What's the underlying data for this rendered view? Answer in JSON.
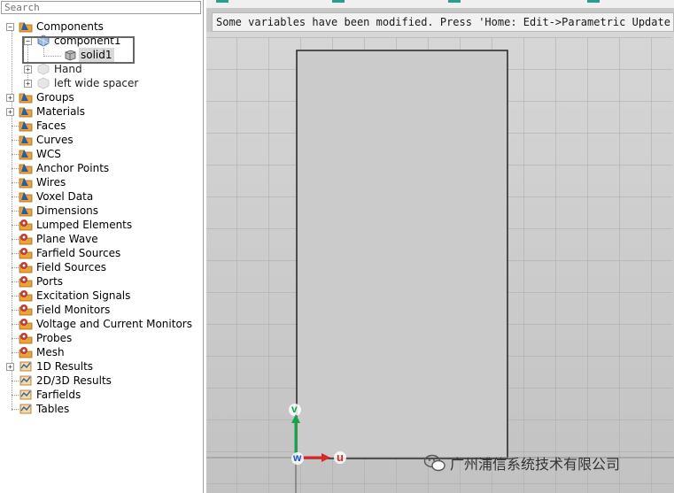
{
  "search": {
    "placeholder": "Search"
  },
  "tree": {
    "root": "Components",
    "component": "component1",
    "solid": "solid1",
    "extra_items": [
      "Hand",
      "left wide spacer"
    ],
    "items": [
      {
        "label": "Groups",
        "icon": "folder-icon"
      },
      {
        "label": "Materials",
        "icon": "folder-icon"
      },
      {
        "label": "Faces",
        "icon": "folder-icon"
      },
      {
        "label": "Curves",
        "icon": "folder-icon"
      },
      {
        "label": "WCS",
        "icon": "folder-icon"
      },
      {
        "label": "Anchor Points",
        "icon": "folder-icon"
      },
      {
        "label": "Wires",
        "icon": "folder-icon"
      },
      {
        "label": "Voxel Data",
        "icon": "folder-icon"
      },
      {
        "label": "Dimensions",
        "icon": "folder-icon"
      },
      {
        "label": "Lumped Elements",
        "icon": "gear-folder-icon"
      },
      {
        "label": "Plane Wave",
        "icon": "gear-folder-icon"
      },
      {
        "label": "Farfield Sources",
        "icon": "gear-folder-icon"
      },
      {
        "label": "Field Sources",
        "icon": "gear-folder-icon"
      },
      {
        "label": "Ports",
        "icon": "gear-folder-icon"
      },
      {
        "label": "Excitation Signals",
        "icon": "gear-folder-icon"
      },
      {
        "label": "Field Monitors",
        "icon": "gear-folder-icon"
      },
      {
        "label": "Voltage and Current Monitors",
        "icon": "gear-folder-icon"
      },
      {
        "label": "Probes",
        "icon": "gear-folder-icon"
      },
      {
        "label": "Mesh",
        "icon": "gear-folder-icon"
      },
      {
        "label": "1D Results",
        "icon": "results-icon"
      },
      {
        "label": "2D/3D Results",
        "icon": "results-icon"
      },
      {
        "label": "Farfields",
        "icon": "results-icon"
      },
      {
        "label": "Tables",
        "icon": "results-icon"
      }
    ]
  },
  "viewport": {
    "message": "Some variables have been modified. Press 'Home: Edit->Parametric Update (F7)'",
    "axes": {
      "v": "v",
      "u": "u",
      "w": "w"
    }
  },
  "watermark": {
    "text": "广州浦信系统技术有限公司"
  },
  "colors": {
    "folder": "#e8a33a",
    "gear": "#c0392b",
    "teal": "#2a9d8f",
    "axis_v": "#16a34a",
    "axis_u": "#dc2626",
    "axis_w": "#1d4ed8"
  }
}
